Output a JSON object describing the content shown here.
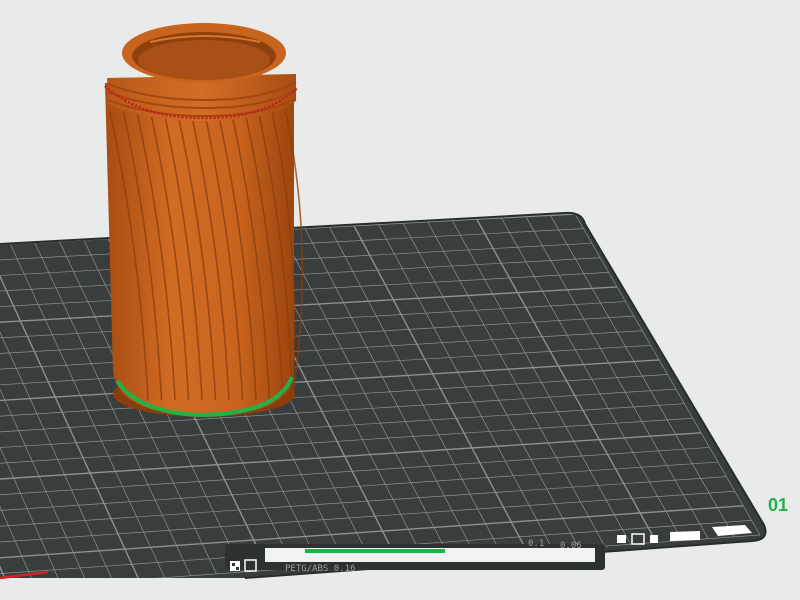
{
  "viewport": {
    "background_color": "#e9eaea",
    "bed": {
      "color": "#3a3d3d",
      "grid_color": "#8d9191",
      "edge_color": "#2a2c2c"
    },
    "model": {
      "color": "#c8641e",
      "top_contact_color": "#c41e1e",
      "bottom_contact_color": "#21b34a"
    },
    "corner_label": "01",
    "corner_label_color": "#21b34a",
    "axis_x_color": "#d42020",
    "bottom_bar": {
      "file_text": "PETG/ABS 0.16",
      "right_text_1": "0.1",
      "right_text_2": "0.06"
    }
  }
}
